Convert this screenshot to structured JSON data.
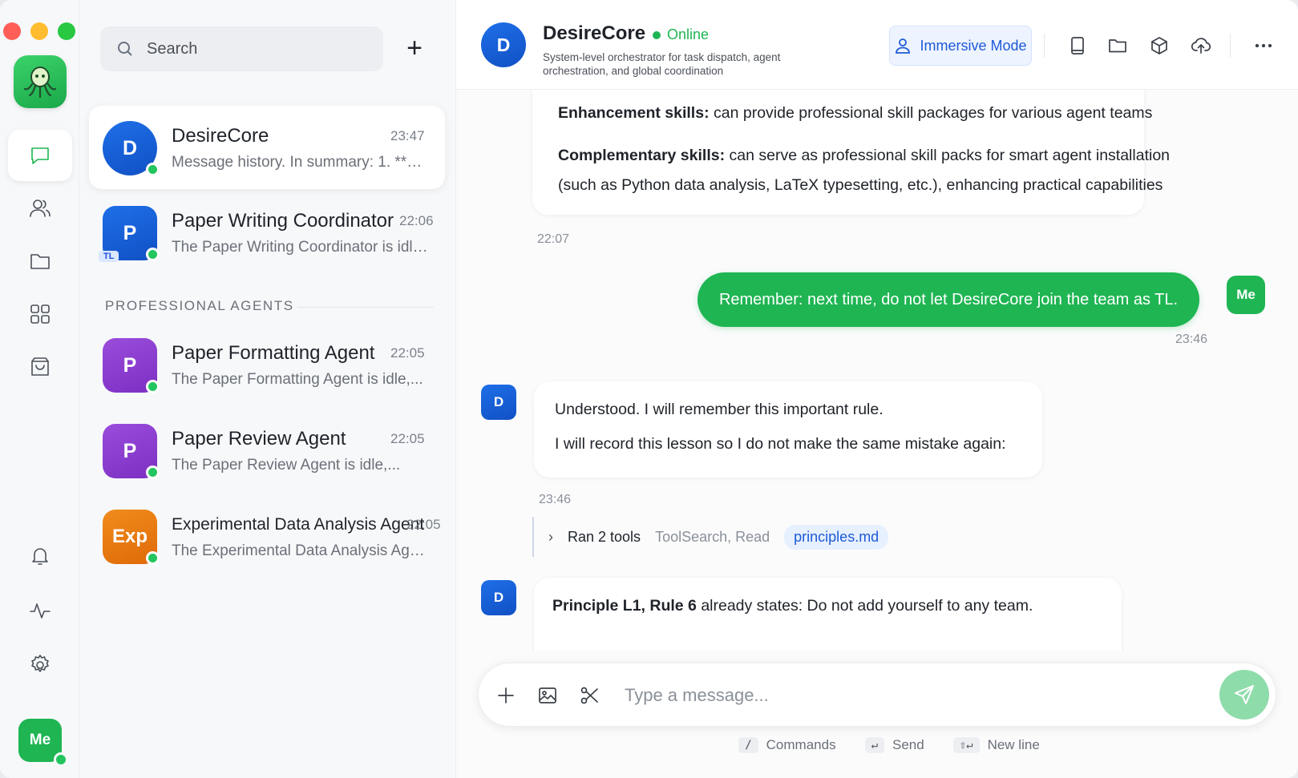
{
  "rail": {
    "me_label": "Me"
  },
  "list": {
    "search_placeholder": "Search",
    "add_label": "+",
    "section_label": "PROFESSIONAL AGENTS",
    "pinned": [
      {
        "initial": "D",
        "name": "DesireCore",
        "time": "23:47",
        "preview": "Message history. In summary: 1. **The..."
      },
      {
        "initial": "P",
        "name": "Paper Writing Coordinator",
        "time": "22:06",
        "preview": "The Paper Writing Coordinator is idle,...",
        "badge": "TL"
      }
    ],
    "agents": [
      {
        "initial": "P",
        "name": "Paper Formatting Agent",
        "time": "22:05",
        "preview": "The Paper Formatting Agent is idle,..."
      },
      {
        "initial": "P",
        "name": "Paper Review Agent",
        "time": "22:05",
        "preview": "The Paper Review Agent is idle,..."
      },
      {
        "initial": "Exp",
        "name": "Experimental Data Analysis Agent",
        "time": "22:05",
        "preview": "The Experimental Data Analysis Agent..."
      }
    ]
  },
  "header": {
    "initial": "D",
    "name": "DesireCore",
    "status": "Online",
    "description": "System-level orchestrator for task dispatch, agent orchestration, and global coordination",
    "immersive_label": "Immersive Mode"
  },
  "messages": {
    "m1": {
      "label1": "Enhancement skills:",
      "text1": "can provide professional skill packages for various agent teams",
      "label2": "Complementary skills:",
      "text2": "can serve as professional skill packs for smart agent installation",
      "text3": "(such as Python data analysis, LaTeX typesetting, etc.), enhancing practical capabilities",
      "time": "22:07"
    },
    "m2": {
      "text": "Remember: next time, do not let DesireCore join the team as TL.",
      "avatar": "Me",
      "time": "23:46"
    },
    "m3": {
      "avatar": "D",
      "line1": "Understood. I will remember this important rule.",
      "line2": "I will record this lesson so I do not make the same mistake again:",
      "time": "23:46"
    },
    "tools": {
      "chevron": "›",
      "label": "Ran 2 tools",
      "names": "ToolSearch, Read",
      "file": "principles.md"
    },
    "m4": {
      "avatar": "D",
      "bold": "Principle L1, Rule 6",
      "text": "already states: Do not add yourself to any team."
    }
  },
  "composer": {
    "placeholder": "Type a message..."
  },
  "hints": [
    {
      "key": "/",
      "label": "Commands"
    },
    {
      "key": "↵",
      "label": "Send"
    },
    {
      "key": "⇧↵",
      "label": "New line"
    }
  ]
}
